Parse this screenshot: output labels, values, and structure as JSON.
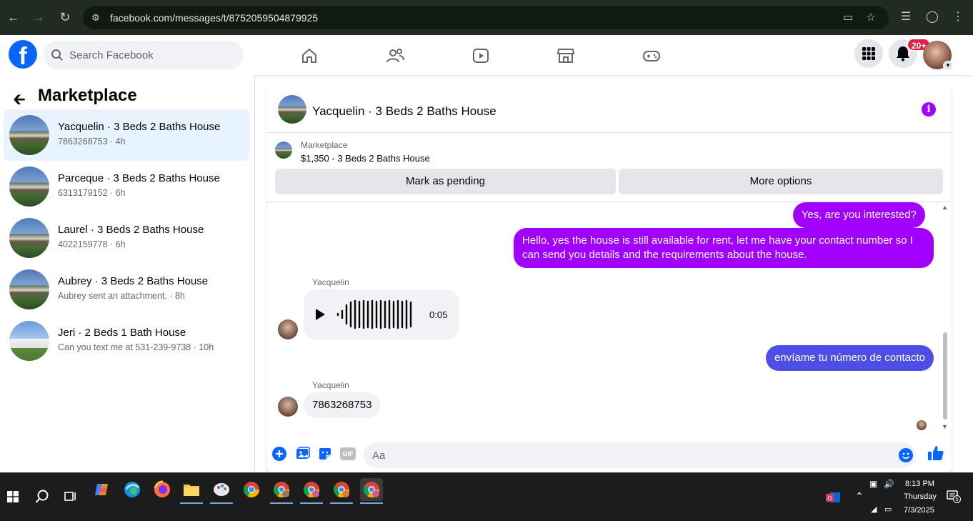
{
  "browser": {
    "url": "facebook.com/messages/t/8752059504879925"
  },
  "facebook": {
    "search_placeholder": "Search Facebook",
    "notification_badge": "20+",
    "brand_color": "#0866ff"
  },
  "sidebar": {
    "title": "Marketplace",
    "conversations": [
      {
        "name": "Yacquelin · 3 Beds 2 Baths House",
        "sub": "7863268753 · 4h"
      },
      {
        "name": "Parceque · 3 Beds 2 Baths House",
        "sub": "6313179152 · 6h"
      },
      {
        "name": "Laurel · 3 Beds 2 Baths House",
        "sub": "4022159778 · 6h"
      },
      {
        "name": "Aubrey · 3 Beds 2 Baths House",
        "sub": "Aubrey sent an attachment. · 8h"
      },
      {
        "name": "Jeri · 2 Beds 1 Bath House",
        "sub": "Can you text me at 531-239-9738 · 10h"
      }
    ]
  },
  "chat": {
    "title": "Yacquelin · 3 Beds 2 Baths House",
    "listing_source": "Marketplace",
    "listing_price": "$1,350 - 3 Beds 2 Baths House",
    "mark_pending": "Mark as pending",
    "more_options": "More options",
    "messages": {
      "m1": "Yes, are you interested?",
      "m2": "Hello, yes the house is still available for rent, let me have your contact number so I can send you details and the requirements about the house.",
      "sender1": "Yacquelin",
      "audio_duration": "0:05",
      "m3": "envíame tu número de contacto",
      "sender2": "Yacquelin",
      "m4": "7863268753"
    },
    "composer_placeholder": "Aa",
    "gif_label": "GIF",
    "outgoing_color": "#a100ff"
  },
  "taskbar": {
    "time": "8:13 PM",
    "day": "Thursday",
    "date": "7/3/2025",
    "notif_count": "5"
  }
}
